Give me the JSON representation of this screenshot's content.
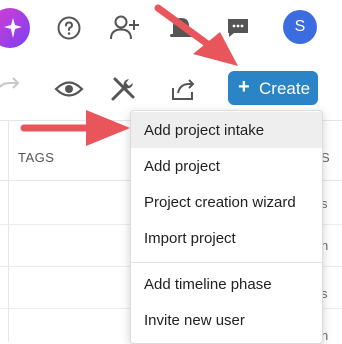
{
  "header": {
    "avatar_initial": "S"
  },
  "toolbar": {
    "create_label": "Create",
    "create_plus": "+"
  },
  "table": {
    "tags_header": "TAGS",
    "edge_letters": [
      "S",
      "s",
      "n",
      "s",
      "n"
    ]
  },
  "menu": {
    "items": [
      {
        "label": "Add project intake",
        "highlighted": true
      },
      {
        "label": "Add project"
      },
      {
        "label": "Project creation wizard"
      },
      {
        "label": "Import project"
      },
      {
        "label": "Add timeline phase"
      },
      {
        "label": "Invite new user"
      }
    ]
  },
  "colors": {
    "accent": "#2b84c6",
    "annotation_arrow": "#e8555a",
    "avatar": "#3b6ce0"
  }
}
